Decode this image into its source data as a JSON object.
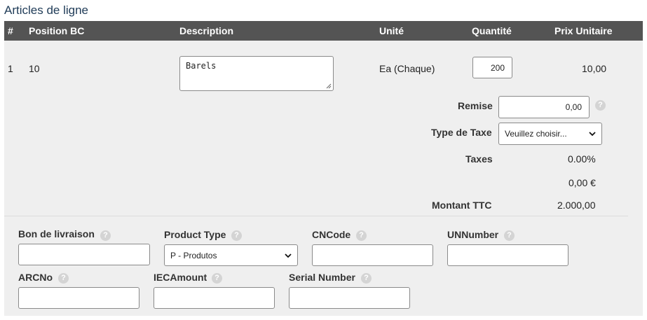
{
  "section_title": "Articles de ligne",
  "columns": {
    "index": "#",
    "position": "Position BC",
    "description": "Description",
    "unit": "Unité",
    "quantity": "Quantité",
    "unit_price": "Prix Unitaire"
  },
  "row": {
    "index": "1",
    "position": "10",
    "description": "Barels",
    "unit": "Ea (Chaque)",
    "quantity": "200",
    "unit_price": "10,00"
  },
  "details": {
    "discount_label": "Remise",
    "discount_value": "0,00",
    "tax_type_label": "Type de Taxe",
    "tax_type_value": "Veuillez choisir...",
    "taxes_label": "Taxes",
    "taxes_percent": "0.00%",
    "taxes_amount": "0,00 €",
    "total_label": "Montant TTC",
    "total_value": "2.000,00"
  },
  "extra_fields": {
    "delivery_note_label": "Bon de livraison",
    "delivery_note_value": "",
    "product_type_label": "Product Type",
    "product_type_value": "P - Produtos",
    "cncode_label": "CNCode",
    "cncode_value": "",
    "unnumber_label": "UNNumber",
    "unnumber_value": "",
    "arcno_label": "ARCNo",
    "arcno_value": "",
    "iecamount_label": "IECAmount",
    "iecamount_value": "",
    "serial_label": "Serial Number",
    "serial_value": ""
  },
  "help_glyph": "?",
  "icons": [
    "help-icon",
    "chevron-down-icon",
    "resize-grip-icon"
  ]
}
